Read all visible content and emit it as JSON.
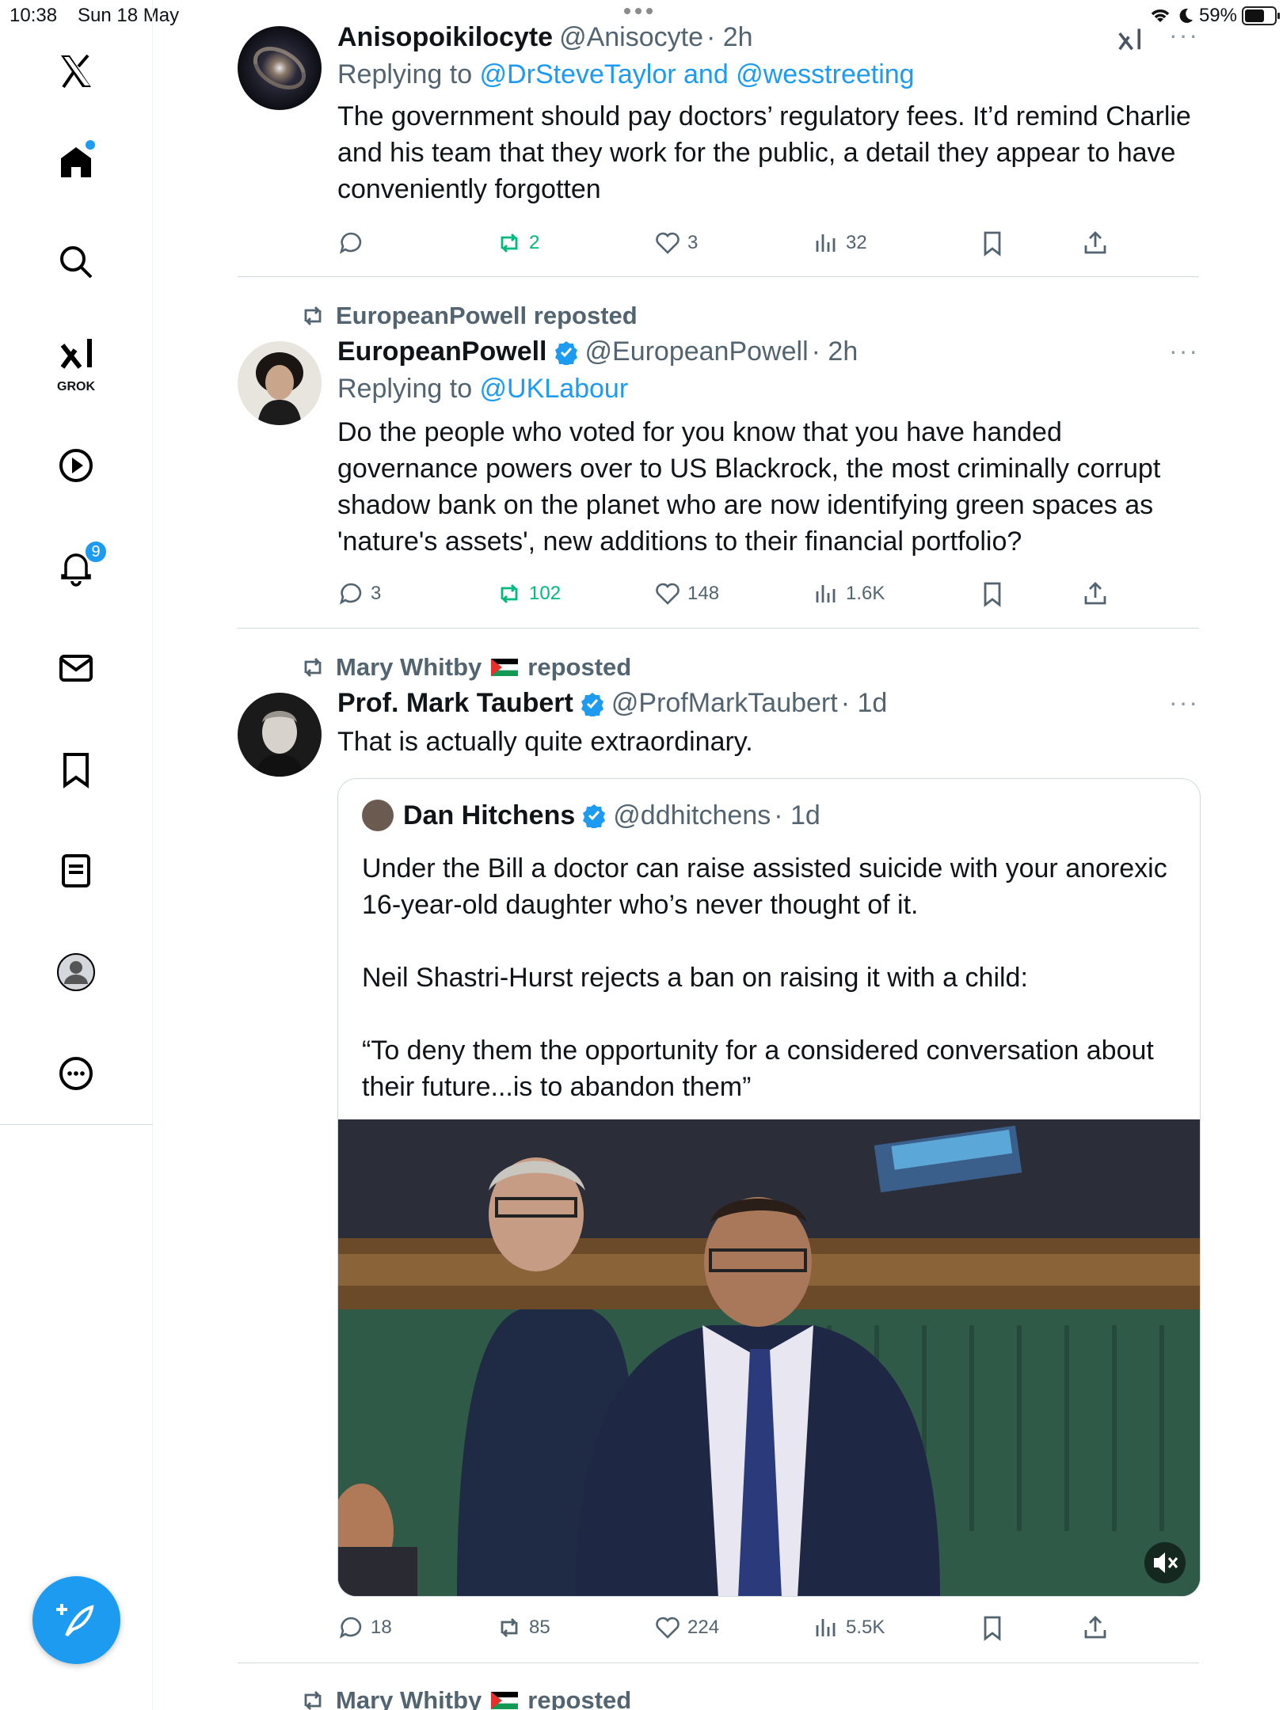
{
  "status_bar": {
    "time": "10:38",
    "date": "Sun 18 May",
    "battery": "59%"
  },
  "sidebar": {
    "grok_label": "GROK",
    "notifications_badge": "9"
  },
  "tweets": [
    {
      "name": "Anisopoikilocyte",
      "handle": "@Anisocyte",
      "time": "· 2h",
      "reply_prefix": "Replying to ",
      "reply_to": "@DrSteveTaylor and @wesstreeting",
      "text": "The government should pay doctors’ regulatory fees. It’d remind Charlie and his team that they work for the public, a detail they appear to have conveniently forgotten",
      "stats": {
        "replies": "",
        "reposts": "2",
        "likes": "3",
        "views": "32"
      }
    },
    {
      "repost_by": "EuropeanPowell reposted",
      "name": "EuropeanPowell",
      "handle": "@EuropeanPowell",
      "time": "· 2h",
      "reply_prefix": "Replying to ",
      "reply_to": "@UKLabour",
      "text": "Do the people who voted for you know that you have handed governance powers over to US Blackrock, the most criminally corrupt shadow bank on the planet who are now identifying green spaces as 'nature's assets', new additions to their financial portfolio?",
      "stats": {
        "replies": "3",
        "reposts": "102",
        "likes": "148",
        "views": "1.6K"
      }
    },
    {
      "repost_by_name": "Mary Whitby",
      "repost_suffix": "reposted",
      "name": "Prof. Mark Taubert",
      "handle": "@ProfMarkTaubert",
      "time": "· 1d",
      "text": "That is actually quite extraordinary.",
      "quote": {
        "name": "Dan Hitchens",
        "handle": "@ddhitchens",
        "time": "· 1d",
        "p1": "Under the Bill a doctor can raise assisted suicide with your anorexic 16-year-old daughter who’s never thought of it.",
        "p2": "Neil Shastri-Hurst rejects a ban on raising it with a child:",
        "p3": "“To deny them the opportunity for a considered conversation about their future...is to abandon them”"
      },
      "stats": {
        "replies": "18",
        "reposts": "85",
        "likes": "224",
        "views": "5.5K"
      }
    },
    {
      "repost_by_name": "Mary Whitby",
      "repost_suffix": "reposted"
    }
  ]
}
